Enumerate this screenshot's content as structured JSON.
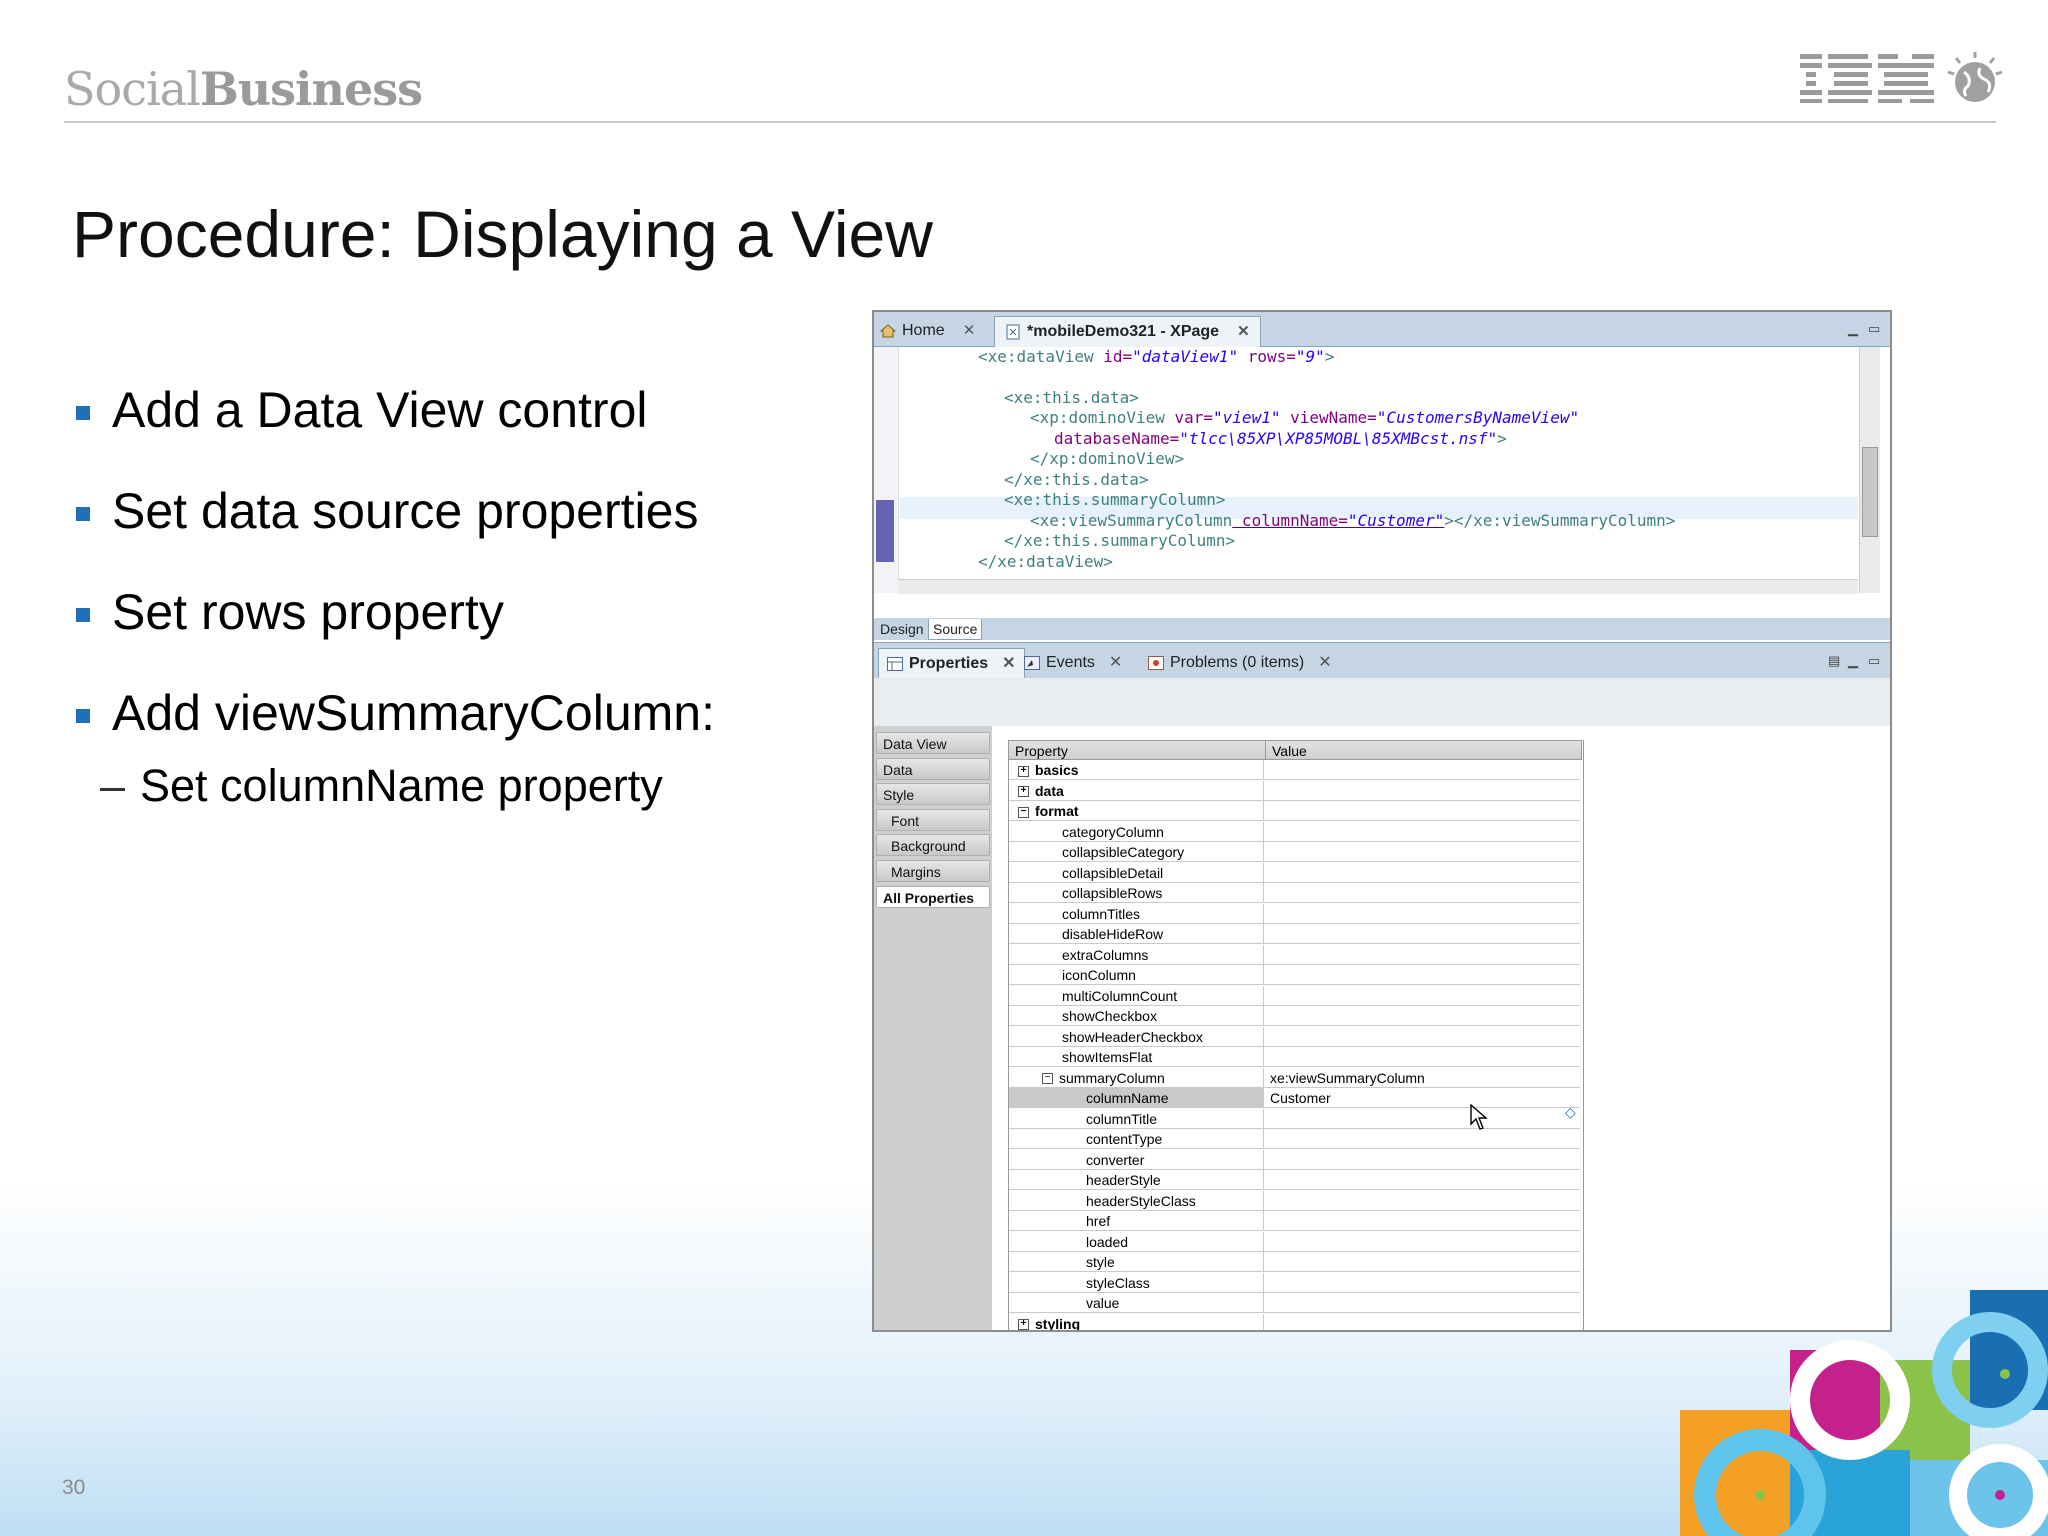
{
  "header": {
    "brand_light": "Social",
    "brand_bold": "Business",
    "logo_text": "IBM"
  },
  "slide": {
    "title": "Procedure:  Displaying a View",
    "bullets": [
      "Add a Data View control",
      "Set data source properties",
      "Set rows property",
      "Add viewSummaryColumn:"
    ],
    "subbullet": "Set columnName property",
    "page_number": "30"
  },
  "editor": {
    "tabs": [
      {
        "label": "Home",
        "icon": "home-icon"
      },
      {
        "label": "*mobileDemo321 - XPage",
        "icon": "xpage-icon"
      }
    ],
    "code": {
      "line1": {
        "tag": "<xe:dataView",
        "a1": " id=",
        "v1": "\"dataView1\"",
        "a2": " rows=",
        "v2": "\"9\"",
        "end": ">"
      },
      "line2": "<xe:this.data>",
      "line3": {
        "tag": "<xp:dominoView",
        "a1": " var=",
        "v1": "\"view1\"",
        "a2": " viewName=",
        "v2": "\"CustomersByNameView\""
      },
      "line4": {
        "a1": "databaseName=",
        "v1": "\"tlcc\\85XP\\XP85MOBL\\85XMBcst.nsf\"",
        "end": ">"
      },
      "line5": "</xp:dominoView>",
      "line6": "</xe:this.data>",
      "line7": "<xe:this.summaryColumn>",
      "line8": {
        "tag": "<xe:viewSummaryColumn",
        "a1": " columnName=",
        "v1": "\"Customer\"",
        "end": "></xe:viewSummaryColumn>"
      },
      "line9": "</xe:this.summaryColumn>",
      "line10": "</xe:dataView>"
    },
    "mode_tabs": {
      "design": "Design",
      "source": "Source"
    }
  },
  "panel": {
    "tabs": [
      {
        "label": "Properties",
        "icon": "properties-icon"
      },
      {
        "label": "Events",
        "icon": "events-icon"
      },
      {
        "label": "Problems (0 items)",
        "icon": "problems-icon"
      }
    ],
    "left_tabs": [
      "Data View",
      "Data",
      "Style",
      "Font",
      "Background",
      "Margins",
      "All Properties"
    ],
    "columns": {
      "property": "Property",
      "value": "Value"
    },
    "rows": [
      {
        "name": "basics",
        "value": "",
        "level": 0,
        "group": "plus"
      },
      {
        "name": "data",
        "value": "",
        "level": 0,
        "group": "plus"
      },
      {
        "name": "format",
        "value": "",
        "level": 0,
        "group": "minus"
      },
      {
        "name": "categoryColumn",
        "value": "",
        "level": 1
      },
      {
        "name": "collapsibleCategory",
        "value": "",
        "level": 1
      },
      {
        "name": "collapsibleDetail",
        "value": "",
        "level": 1
      },
      {
        "name": "collapsibleRows",
        "value": "",
        "level": 1
      },
      {
        "name": "columnTitles",
        "value": "",
        "level": 1
      },
      {
        "name": "disableHideRow",
        "value": "",
        "level": 1
      },
      {
        "name": "extraColumns",
        "value": "",
        "level": 1
      },
      {
        "name": "iconColumn",
        "value": "",
        "level": 1
      },
      {
        "name": "multiColumnCount",
        "value": "",
        "level": 1
      },
      {
        "name": "showCheckbox",
        "value": "",
        "level": 1
      },
      {
        "name": "showHeaderCheckbox",
        "value": "",
        "level": 1
      },
      {
        "name": "showItemsFlat",
        "value": "",
        "level": 1
      },
      {
        "name": "summaryColumn",
        "value": "xe:viewSummaryColumn",
        "level": 1,
        "group": "minus"
      },
      {
        "name": "columnName",
        "value": "Customer",
        "level": 2,
        "selected": true
      },
      {
        "name": "columnTitle",
        "value": "",
        "level": 2
      },
      {
        "name": "contentType",
        "value": "",
        "level": 2
      },
      {
        "name": "converter",
        "value": "",
        "level": 2
      },
      {
        "name": "headerStyle",
        "value": "",
        "level": 2
      },
      {
        "name": "headerStyleClass",
        "value": "",
        "level": 2
      },
      {
        "name": "href",
        "value": "",
        "level": 2
      },
      {
        "name": "loaded",
        "value": "",
        "level": 2
      },
      {
        "name": "style",
        "value": "",
        "level": 2
      },
      {
        "name": "styleClass",
        "value": "",
        "level": 2
      },
      {
        "name": "value",
        "value": "",
        "level": 2
      },
      {
        "name": "styling",
        "value": "",
        "level": 0,
        "group": "plus"
      }
    ]
  },
  "colors": {
    "bullet": "#1f70b6",
    "tab_bar": "#c6d5e4"
  }
}
